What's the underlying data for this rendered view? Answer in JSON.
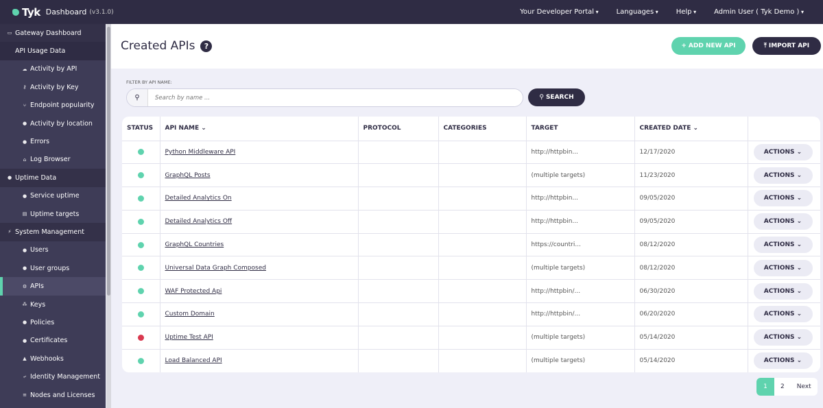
{
  "topbar": {
    "brand": "Tyk",
    "app": "Dashboard",
    "version": "(v3.1.0)",
    "nav": [
      "Your Developer Portal",
      "Languages",
      "Help",
      "Admin User ( Tyk Demo )"
    ]
  },
  "sidebar": [
    {
      "label": "Gateway Dashboard",
      "type": "head",
      "icon": "▭"
    },
    {
      "label": "API Usage Data",
      "type": "sub",
      "icon": ""
    },
    {
      "label": "Activity by API",
      "type": "item",
      "icon": "☁"
    },
    {
      "label": "Activity by Key",
      "type": "item",
      "icon": "⚷"
    },
    {
      "label": "Endpoint popularity",
      "type": "item",
      "icon": "⑂"
    },
    {
      "label": "Activity by location",
      "type": "item",
      "icon": "●"
    },
    {
      "label": "Errors",
      "type": "item",
      "icon": "●"
    },
    {
      "label": "Log Browser",
      "type": "item",
      "icon": "⌂"
    },
    {
      "label": "Uptime Data",
      "type": "sub2",
      "icon": "●"
    },
    {
      "label": "Service uptime",
      "type": "item",
      "icon": "●"
    },
    {
      "label": "Uptime targets",
      "type": "item",
      "icon": "▤"
    },
    {
      "label": "System Management",
      "type": "sub2",
      "icon": "⚡"
    },
    {
      "label": "Users",
      "type": "item",
      "icon": "●"
    },
    {
      "label": "User groups",
      "type": "item",
      "icon": "●"
    },
    {
      "label": "APIs",
      "type": "active",
      "icon": "⚙"
    },
    {
      "label": "Keys",
      "type": "item",
      "icon": "⁂"
    },
    {
      "label": "Policies",
      "type": "item",
      "icon": "●"
    },
    {
      "label": "Certificates",
      "type": "item",
      "icon": "●"
    },
    {
      "label": "Webhooks",
      "type": "item",
      "icon": "▲"
    },
    {
      "label": "Identity Management",
      "type": "item",
      "icon": "⤶"
    },
    {
      "label": "Nodes and Licenses",
      "type": "item",
      "icon": "≡"
    }
  ],
  "page": {
    "title": "Created APIs",
    "help": "?",
    "add_label": "ADD NEW API",
    "import_label": "IMPORT API"
  },
  "filter": {
    "label": "FILTER BY API NAME:",
    "placeholder": "Search by name ...",
    "search_label": "SEARCH"
  },
  "table": {
    "headers": [
      "STATUS",
      "API NAME",
      "PROTOCOL",
      "CATEGORIES",
      "TARGET",
      "CREATED DATE",
      ""
    ],
    "rows": [
      {
        "status": "up",
        "name": "Python Middleware API",
        "protocol": "",
        "categories": "",
        "target": "http://httpbin...",
        "created": "12/17/2020",
        "action": "ACTIONS"
      },
      {
        "status": "up",
        "name": "GraphQL Posts",
        "protocol": "",
        "categories": "",
        "target": "(multiple targets)",
        "created": "11/23/2020",
        "action": "ACTIONS"
      },
      {
        "status": "up",
        "name": "Detailed Analytics On",
        "protocol": "",
        "categories": "",
        "target": "http://httpbin...",
        "created": "09/05/2020",
        "action": "ACTIONS"
      },
      {
        "status": "up",
        "name": "Detailed Analytics Off",
        "protocol": "",
        "categories": "",
        "target": "http://httpbin...",
        "created": "09/05/2020",
        "action": "ACTIONS"
      },
      {
        "status": "up",
        "name": "GraphQL Countries",
        "protocol": "",
        "categories": "",
        "target": "https://countri...",
        "created": "08/12/2020",
        "action": "ACTIONS"
      },
      {
        "status": "up",
        "name": "Universal Data Graph Composed",
        "protocol": "",
        "categories": "",
        "target": "(multiple targets)",
        "created": "08/12/2020",
        "action": "ACTIONS"
      },
      {
        "status": "up",
        "name": "WAF Protected Api",
        "protocol": "",
        "categories": "",
        "target": "http://httpbin/...",
        "created": "06/30/2020",
        "action": "ACTIONS"
      },
      {
        "status": "up",
        "name": "Custom Domain",
        "protocol": "",
        "categories": "",
        "target": "http://httpbin/...",
        "created": "06/20/2020",
        "action": "ACTIONS"
      },
      {
        "status": "down",
        "name": "Uptime Test API",
        "protocol": "",
        "categories": "",
        "target": "(multiple targets)",
        "created": "05/14/2020",
        "action": "ACTIONS"
      },
      {
        "status": "up",
        "name": "Load Balanced API",
        "protocol": "",
        "categories": "",
        "target": "(multiple targets)",
        "created": "05/14/2020",
        "action": "ACTIONS"
      }
    ]
  },
  "colors": {
    "up": "#5fd3ae",
    "down": "#d9394f"
  },
  "pagination": {
    "pages": [
      "1",
      "2"
    ],
    "current": "1",
    "next": "Next"
  }
}
